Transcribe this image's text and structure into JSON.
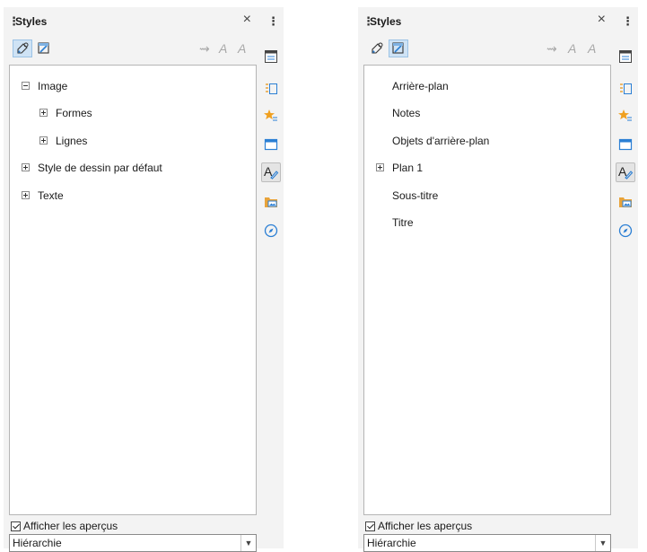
{
  "colors": {
    "accent": "#2b7fd4",
    "panel_bg": "#f3f3f3",
    "star": "#f0a020",
    "folder": "#e8a33a"
  },
  "icons": {
    "fill_format": "fill-format-icon",
    "new_style": "new-style-from-selection-icon",
    "update_style": "update-style-icon",
    "properties": "properties-icon",
    "styles": "styles-icon"
  },
  "left_panel": {
    "title": "Styles",
    "close": "×",
    "tree": [
      {
        "label": "Image",
        "expander": "minus",
        "level": 0
      },
      {
        "label": "Formes",
        "expander": "plus",
        "level": 1
      },
      {
        "label": "Lignes",
        "expander": "plus",
        "level": 1
      },
      {
        "label": "Style de dessin par défaut",
        "expander": "plus",
        "level": 0
      },
      {
        "label": "Texte",
        "expander": "plus",
        "level": 0
      }
    ],
    "show_previews_label": "Afficher les aperçus",
    "show_previews_checked": true,
    "filter_value": "Hiérarchie"
  },
  "right_panel": {
    "title": "Styles",
    "close": "×",
    "list": [
      {
        "label": "Arrière-plan",
        "expander": "none"
      },
      {
        "label": "Notes",
        "expander": "none"
      },
      {
        "label": "Objets d'arrière-plan",
        "expander": "none"
      },
      {
        "label": "Plan 1",
        "expander": "plus"
      },
      {
        "label": "Sous-titre",
        "expander": "none"
      },
      {
        "label": "Titre",
        "expander": "none"
      }
    ],
    "show_previews_label": "Afficher les aperçus",
    "show_previews_checked": true,
    "filter_value": "Hiérarchie"
  },
  "deck": {
    "menu": "⋮"
  }
}
